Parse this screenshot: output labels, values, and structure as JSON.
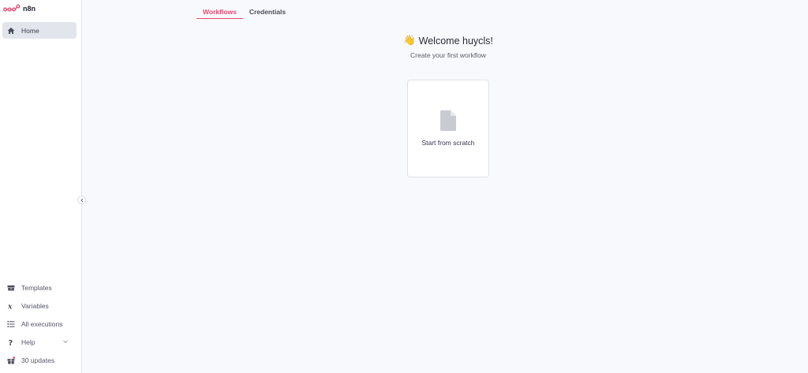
{
  "app": {
    "name": "n8n",
    "brand_color": "#ea4b71"
  },
  "sidebar": {
    "top_items": [
      {
        "label": "Home",
        "icon": "home-icon",
        "active": true
      }
    ],
    "bottom_items": [
      {
        "label": "Templates",
        "icon": "box-icon"
      },
      {
        "label": "Variables",
        "icon": "variable-icon"
      },
      {
        "label": "All executions",
        "icon": "list-icon"
      },
      {
        "label": "Help",
        "icon": "question-icon"
      },
      {
        "label": "30 updates",
        "icon": "gift-icon"
      }
    ]
  },
  "tabs": [
    {
      "label": "Workflows",
      "active": true
    },
    {
      "label": "Credentials",
      "active": false
    }
  ],
  "welcome": {
    "emoji": "👋",
    "title": "Welcome huycls!",
    "subtitle": "Create your first workflow"
  },
  "card": {
    "label": "Start from scratch",
    "icon": "file-icon"
  }
}
